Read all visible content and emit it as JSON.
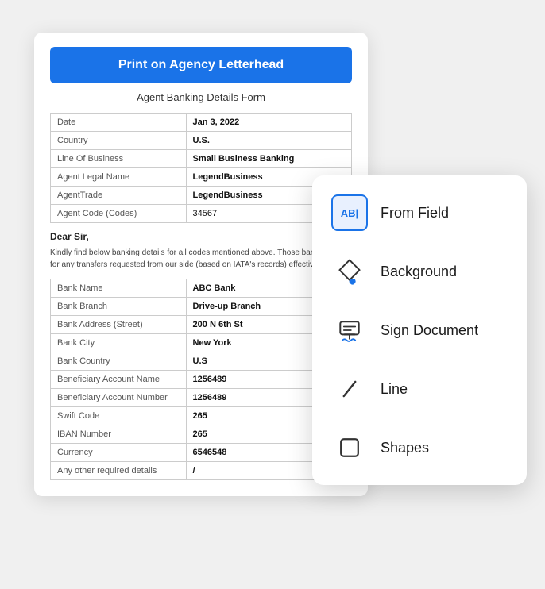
{
  "document": {
    "header_button": "Print on Agency Letterhead",
    "subtitle": "Agent Banking Details Form",
    "table1": [
      {
        "label": "Date",
        "value": "Jan 3, 2022",
        "bold": true
      },
      {
        "label": "Country",
        "value": "U.S.",
        "bold": true
      },
      {
        "label": "Line Of Business",
        "value": "Small Business Banking",
        "bold": true
      },
      {
        "label": "Agent Legal Name",
        "value": "LegendBusiness",
        "bold": true
      },
      {
        "label": "AgentTrade",
        "value": "LegendBusiness",
        "bold": true
      },
      {
        "label": "Agent Code (Codes)",
        "value": "34567",
        "bold": true
      }
    ],
    "salutation": "Dear Sir,",
    "body_text": "Kindly find below banking details for all codes mentioned above. Those banking det... for any transfers requested from our side (based on IATA's records) effective from d...",
    "table2": [
      {
        "label": "Bank Name",
        "value": "ABC Bank"
      },
      {
        "label": "Bank Branch",
        "value": "Drive-up Branch"
      },
      {
        "label": "Bank Address (Street)",
        "value": "200 N 6th St"
      },
      {
        "label": "Bank City",
        "value": "New York"
      },
      {
        "label": "Bank Country",
        "value": "U.S"
      },
      {
        "label": "Beneficiary Account Name",
        "value": "1256489"
      },
      {
        "label": "Beneficiary Account Number",
        "value": "1256489"
      },
      {
        "label": "Swift Code",
        "value": "265"
      },
      {
        "label": "IBAN Number",
        "value": "265"
      },
      {
        "label": "Currency",
        "value": "6546548"
      },
      {
        "label": "Any other required details",
        "value": "/"
      }
    ]
  },
  "menu": {
    "items": [
      {
        "id": "from-field",
        "label": "From Field",
        "icon": "from-field"
      },
      {
        "id": "background",
        "label": "Background",
        "icon": "background"
      },
      {
        "id": "sign-document",
        "label": "Sign Document",
        "icon": "sign"
      },
      {
        "id": "line",
        "label": "Line",
        "icon": "line"
      },
      {
        "id": "shapes",
        "label": "Shapes",
        "icon": "shapes"
      }
    ]
  }
}
